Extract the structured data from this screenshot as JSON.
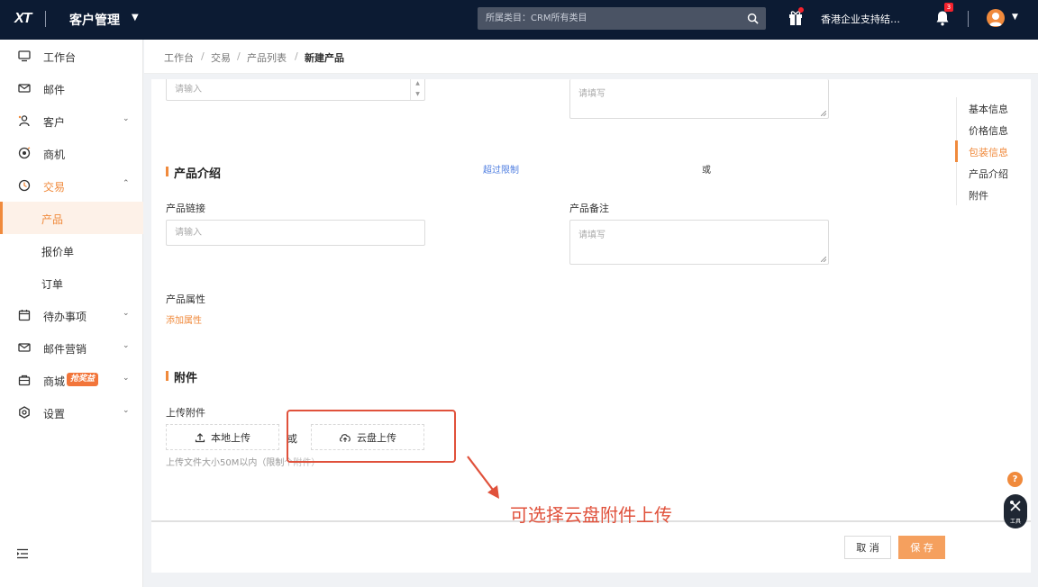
{
  "topbar": {
    "logo": "XT",
    "app_title": "客户管理",
    "search_placeholder": "所属类目：CRM所有类目",
    "company": "香港企业支持结…",
    "notification_count": "3"
  },
  "sidebar": {
    "items": [
      {
        "label": "工作台",
        "icon": "monitor-icon"
      },
      {
        "label": "邮件",
        "icon": "mail-icon"
      },
      {
        "label": "客户",
        "icon": "customer-icon"
      },
      {
        "label": "商机",
        "icon": "opportunity-icon"
      },
      {
        "label": "交易",
        "icon": "deal-icon"
      },
      {
        "label": "产品"
      },
      {
        "label": "报价单"
      },
      {
        "label": "订单"
      },
      {
        "label": "待办事项",
        "icon": "calendar-icon"
      },
      {
        "label": "邮件营销",
        "icon": "email-marketing-icon"
      },
      {
        "label": "商城",
        "icon": "store-icon",
        "badge": "抢奖益"
      },
      {
        "label": "设置",
        "icon": "settings-icon"
      }
    ]
  },
  "breadcrumb": [
    "工作台",
    "交易",
    "产品列表",
    "新建产品"
  ],
  "form": {
    "top_input_placeholder": "请输入",
    "top_textarea_placeholder": "请填写",
    "section_intro": {
      "title": "产品介绍",
      "exceed_link": "超过限制",
      "or_text": "或",
      "link_label": "产品链接",
      "link_placeholder": "请输入",
      "remark_label": "产品备注",
      "remark_placeholder": "请填写",
      "attr_label": "产品属性",
      "add_attr": "添加属性"
    },
    "section_attach": {
      "title": "附件",
      "upload_label": "上传附件",
      "local_upload": "本地上传",
      "or_text": "或",
      "cloud_upload": "云盘上传",
      "hint": "上传文件大小50M以内（限制",
      "hint_tail": "个附件）"
    }
  },
  "anchors": [
    "基本信息",
    "价格信息",
    "包装信息",
    "产品介绍",
    "附件"
  ],
  "anchor_active": "包装信息",
  "footer": {
    "cancel": "取 消",
    "save": "保 存"
  },
  "annotation": "可选择云盘附件上传",
  "fab": {
    "help": "?",
    "tools_label": "工具"
  },
  "colors": {
    "accent": "#f08a3c",
    "topbar": "#0c1b33",
    "link": "#4e7de0",
    "annotation": "#e0513b"
  }
}
